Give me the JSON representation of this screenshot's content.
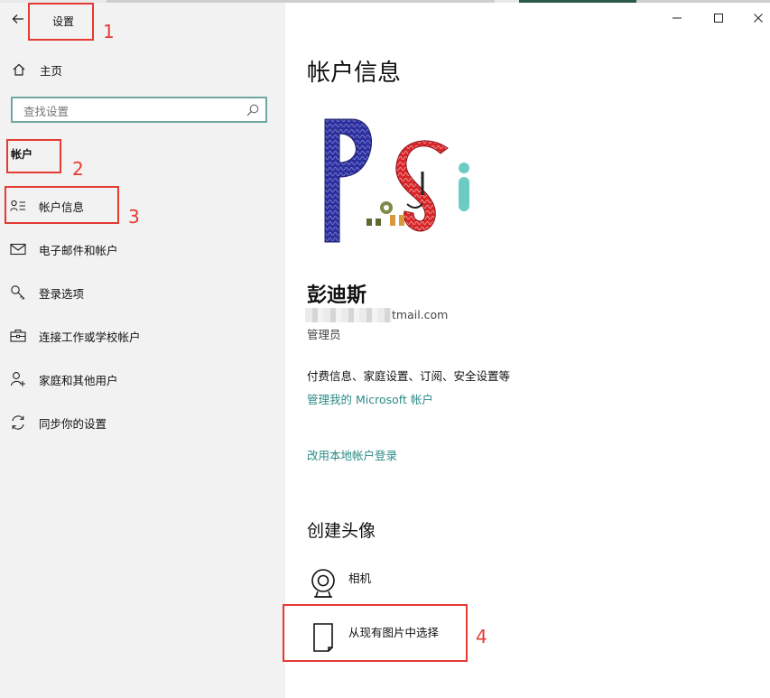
{
  "window": {
    "title": "设置",
    "controls": [
      "minimize-icon",
      "maximize-icon",
      "close-icon"
    ]
  },
  "sidebar": {
    "home_label": "主页",
    "search_placeholder": "查找设置",
    "section_label": "帐户",
    "items": [
      {
        "label": "帐户信息",
        "icon": "person-list-icon",
        "selected": true
      },
      {
        "label": "电子邮件和帐户",
        "icon": "mail-icon"
      },
      {
        "label": "登录选项",
        "icon": "key-icon"
      },
      {
        "label": "连接工作或学校帐户",
        "icon": "briefcase-icon"
      },
      {
        "label": "家庭和其他用户",
        "icon": "person-add-icon"
      },
      {
        "label": "同步你的设置",
        "icon": "sync-icon"
      }
    ]
  },
  "main": {
    "title": "帐户信息",
    "user_name": "彭迪斯",
    "email_visible_suffix": "tmail.com",
    "role": "管理员",
    "billing_text": "付费信息、家庭设置、订阅、安全设置等",
    "manage_link": "管理我的 Microsoft 帐户",
    "local_login_link": "改用本地帐户登录",
    "create_avatar_title": "创建头像",
    "options": [
      {
        "label": "相机",
        "icon": "camera-icon"
      },
      {
        "label": "从现有图片中选择",
        "icon": "browse-file-icon"
      }
    ]
  },
  "annotations": [
    "1",
    "2",
    "3",
    "4"
  ],
  "colors": {
    "accent": "#2a8a86",
    "annotation": "#e53b33",
    "sidebar_bg": "#f2f2f2",
    "search_border": "#6fa8a3"
  }
}
